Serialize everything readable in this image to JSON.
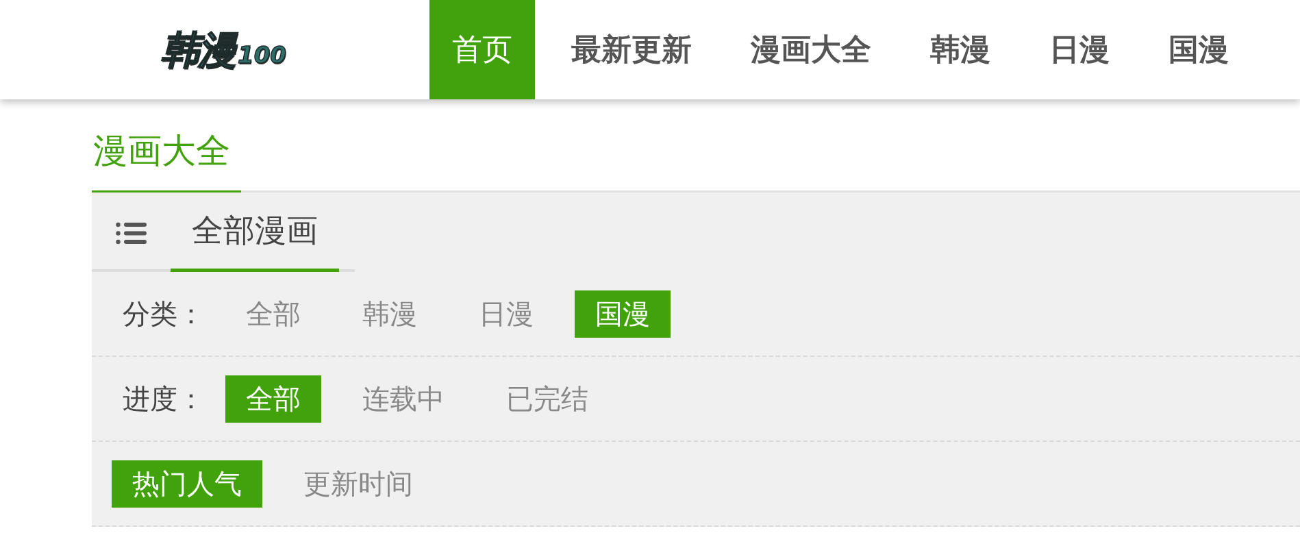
{
  "header": {
    "logo": {
      "text": "韩漫",
      "number": "100"
    },
    "nav": [
      {
        "label": "首页",
        "selected": true
      },
      {
        "label": "最新更新",
        "selected": false
      },
      {
        "label": "漫画大全",
        "selected": false
      },
      {
        "label": "韩漫",
        "selected": false
      },
      {
        "label": "日漫",
        "selected": false
      },
      {
        "label": "国漫",
        "selected": false
      }
    ]
  },
  "section": {
    "title": "漫画大全"
  },
  "panel": {
    "tabs": [
      {
        "label": "全部漫画",
        "selected": true
      }
    ],
    "filters": [
      {
        "label": "分类：",
        "options": [
          {
            "label": "全部",
            "selected": false
          },
          {
            "label": "韩漫",
            "selected": false
          },
          {
            "label": "日漫",
            "selected": false
          },
          {
            "label": "国漫",
            "selected": true
          }
        ]
      },
      {
        "label": "进度：",
        "options": [
          {
            "label": "全部",
            "selected": true
          },
          {
            "label": "连载中",
            "selected": false
          },
          {
            "label": "已完结",
            "selected": false
          }
        ]
      },
      {
        "options": [
          {
            "label": "热门人气",
            "selected": true
          },
          {
            "label": "更新时间",
            "selected": false
          }
        ]
      }
    ]
  }
}
